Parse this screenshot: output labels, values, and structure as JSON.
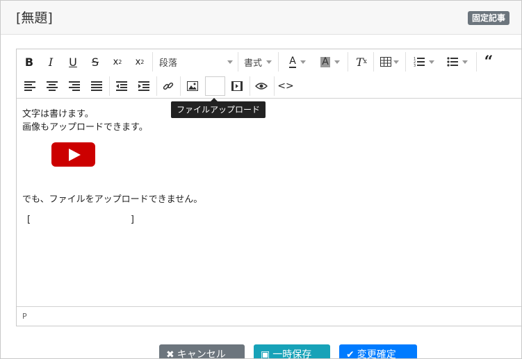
{
  "page": {
    "title": "[無題]",
    "badge": "固定記事"
  },
  "toolbar": {
    "paragraph_label": "段落",
    "style_label": "書式",
    "tooltip": "ファイルアップロード",
    "icons_row1": [
      "bold-icon",
      "italic-icon",
      "underline-icon",
      "strikethrough-icon",
      "subscript-icon",
      "superscript-icon",
      "paragraph-dropdown",
      "style-dropdown",
      "font-color-icon",
      "background-color-icon",
      "clear-format-icon",
      "table-icon",
      "ordered-list-icon",
      "unordered-list-icon",
      "blockquote-icon"
    ],
    "icons_row2": [
      "align-left-icon",
      "align-center-icon",
      "align-right-icon",
      "align-justify-icon",
      "outdent-icon",
      "indent-icon",
      "link-icon",
      "image-icon",
      "file-upload-icon",
      "video-icon",
      "preview-icon",
      "source-code-icon"
    ]
  },
  "content": {
    "line1": "文字は書けます。",
    "line2": "画像もアップロードできます。",
    "line3": "でも、ファイルをアップロードできません。",
    "bracket_open": "[",
    "bracket_close": "]"
  },
  "status": {
    "path": "P"
  },
  "buttons": {
    "cancel": "キャンセル",
    "save": "一時保存",
    "confirm": "変更確定"
  },
  "colors": {
    "badge": "#6c757d",
    "video": "#cc0000",
    "cancel": "#6c757d",
    "save": "#17a2b8",
    "confirm": "#007bff"
  }
}
